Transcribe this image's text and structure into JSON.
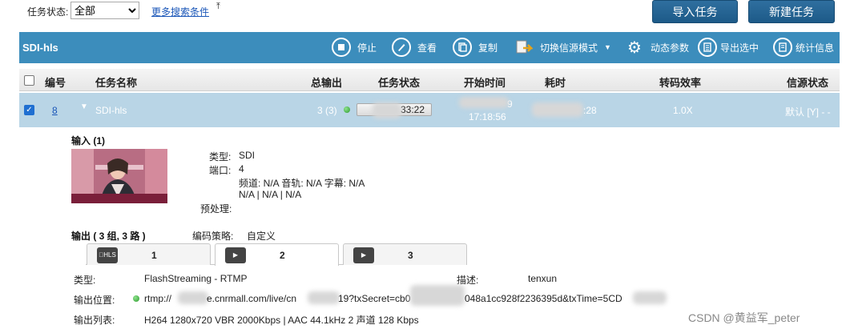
{
  "topbar": {
    "status_label": "任务状态:",
    "status_value": "全部",
    "more_search": "更多搜索条件",
    "import_btn": "导入任务",
    "new_btn": "新建任务"
  },
  "toolbar": {
    "title": "SDI-hls",
    "items": [
      {
        "label": "停止",
        "icon": "stop-icon"
      },
      {
        "label": "查看",
        "icon": "pen-icon"
      },
      {
        "label": "复制",
        "icon": "copy-icon"
      },
      {
        "label": "切换信源模式",
        "icon": "switch-source-icon"
      },
      {
        "label": "动态参数",
        "icon": "gear-icon"
      },
      {
        "label": "导出选中",
        "icon": "export-icon"
      },
      {
        "label": "统计信息",
        "icon": "stats-icon"
      }
    ]
  },
  "table": {
    "headers": {
      "id": "编号",
      "name": "任务名称",
      "output": "总输出",
      "status": "任务状态",
      "start": "开始时间",
      "elapsed": "耗时",
      "efficiency": "转码效率",
      "source_status": "信源状态"
    },
    "row": {
      "id": "8",
      "name": "SDI-hls",
      "output": "3 (3)",
      "status_time": "33:22",
      "start_time": "17:18:56",
      "start_date_fragment": "9",
      "elapsed": ":28",
      "efficiency": "1.0X",
      "source_status": "默认 [Y] - -"
    }
  },
  "detail": {
    "input_title": "输入 (1)",
    "type_label": "类型:",
    "type_value": "SDI",
    "port_label": "端口:",
    "port_value": "4",
    "channel_line": "频道: N/A 音轨: N/A 字幕: N/A",
    "na_line": "N/A | N/A | N/A",
    "preprocess_label": "预处理:",
    "output_title": "输出 ( 3 组, 3 路 )",
    "encode_label": "编码策略:",
    "encode_value": "自定义",
    "tabs": [
      {
        "num": "1",
        "icon": "apple-hls-icon"
      },
      {
        "num": "2",
        "icon": "flash-play-icon"
      },
      {
        "num": "3",
        "icon": "flash-play-icon"
      }
    ],
    "out_type_label": "类型:",
    "out_type_value": "FlashStreaming - RTMP",
    "desc_label": "描述:",
    "desc_value": "tenxun",
    "out_loc_label": "输出位置:",
    "out_loc_a": "rtmp://",
    "out_loc_b": "e.cnrmall.com/live/cn",
    "out_loc_c": "19?txSecret=cb0",
    "out_loc_d": "048a1cc928f2236395d&txTime=5CD",
    "out_list_label": "输出列表:",
    "out_list_value": "H264 1280x720 VBR 2000Kbps | AAC 44.1kHz 2 声道 128 Kbps"
  },
  "watermark": "CSDN @黄益军_peter"
}
